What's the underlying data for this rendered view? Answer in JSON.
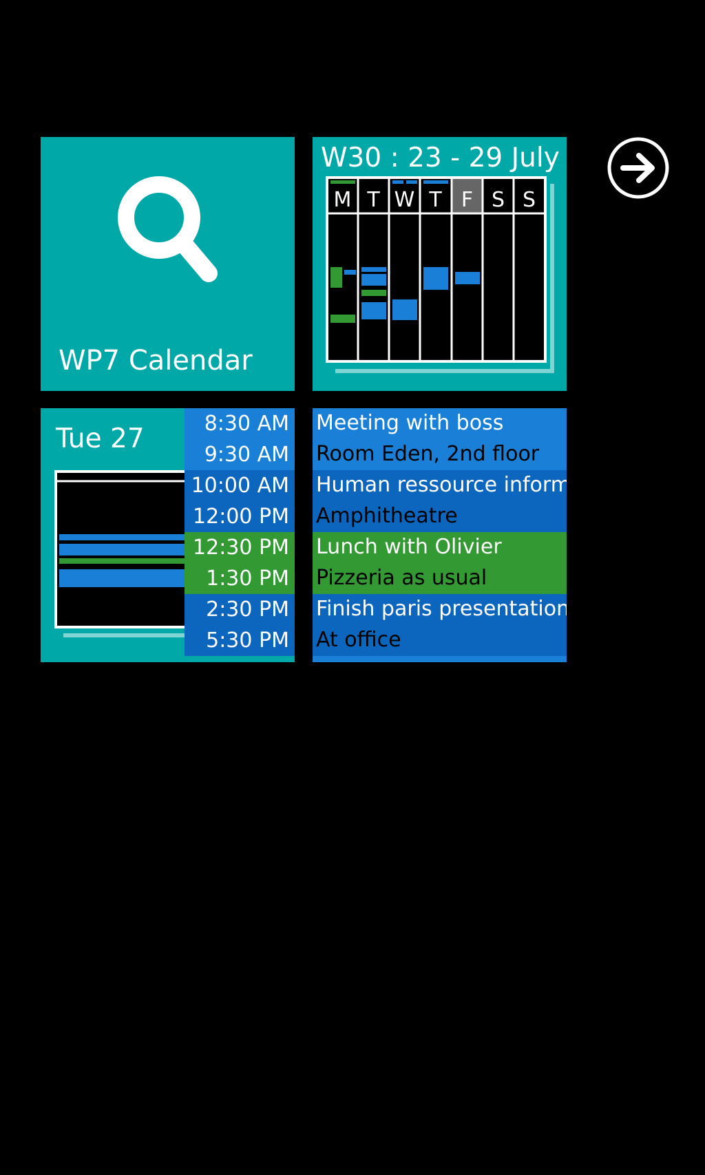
{
  "colors": {
    "tile_teal": "#00a8a8",
    "event_blue": "#1a7fd6",
    "event_blue_dark": "#0d66bd",
    "event_green": "#339933",
    "background": "#000000"
  },
  "app_tile": {
    "label": "WP7 Calendar",
    "icon": "search-icon"
  },
  "week_tile": {
    "title": "W30 : 23 - 29 July",
    "days": [
      "M",
      "T",
      "W",
      "T",
      "F",
      "S",
      "S"
    ]
  },
  "day_tile": {
    "date": "Tue 27",
    "times": [
      "8:30 AM",
      "9:30 AM",
      "10:00 AM",
      "12:00 PM",
      "12:30 PM",
      "1:30 PM",
      "2:30 PM",
      "5:30 PM"
    ]
  },
  "events_tile": {
    "events": [
      {
        "title": "Meeting with boss",
        "place": "Room Eden, 2nd floor",
        "color": "#1a7fd6"
      },
      {
        "title": "Human ressource inform",
        "place": "Amphitheatre",
        "color": "#0d66bd"
      },
      {
        "title": "Lunch with Olivier",
        "place": "Pizzeria as usual",
        "color": "#339933"
      },
      {
        "title": "Finish paris presentation",
        "place": "At office",
        "color": "#0d66bd"
      }
    ]
  },
  "navigation": {
    "next_icon": "arrow-right-circle-icon"
  }
}
